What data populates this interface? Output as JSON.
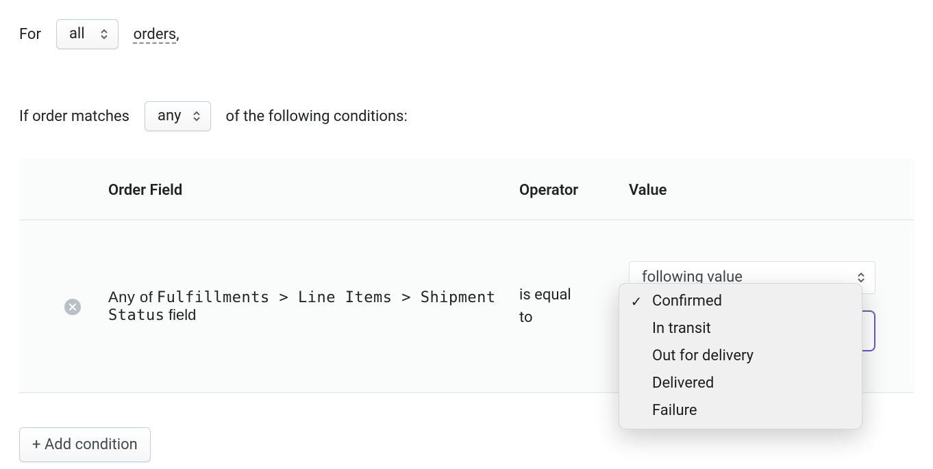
{
  "condition_sentence": {
    "for_label": "For",
    "scope_select": "all",
    "orders_label": "orders",
    "comma": ","
  },
  "match_sentence": {
    "prefix": "If order matches",
    "match_select": "any",
    "suffix": "of the following conditions:"
  },
  "table": {
    "headers": {
      "field": "Order Field",
      "operator": "Operator",
      "value": "Value"
    },
    "rows": [
      {
        "field_prefix": "Any of",
        "field_path": "Fulfillments > Line Items > Shipment Status",
        "field_suffix": "field",
        "operator": "is equal to",
        "value_mode": "following value",
        "value_selected": "Confirmed",
        "value_options": [
          "Confirmed",
          "In transit",
          "Out for delivery",
          "Delivered",
          "Failure"
        ]
      }
    ]
  },
  "add_condition_label": "+ Add condition",
  "icons": {
    "remove": "close-icon",
    "caret": "updown-caret-icon",
    "check": "✓"
  }
}
